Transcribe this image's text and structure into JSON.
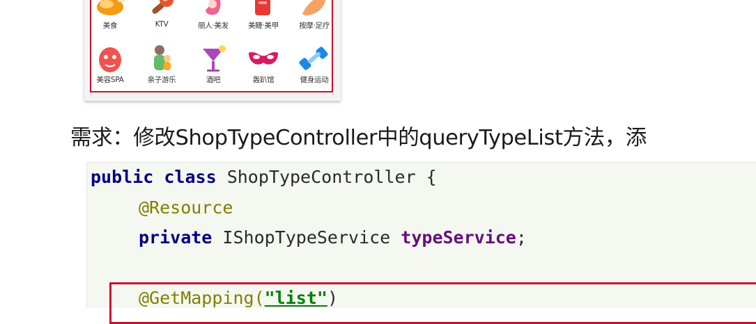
{
  "categories": [
    {
      "label": "美食",
      "icon": "roast-chicken-icon",
      "color": "#f39c12"
    },
    {
      "label": "KTV",
      "icon": "microphone-icon",
      "color": "#e8552b"
    },
    {
      "label": "丽人·美发",
      "icon": "hair-salon-icon",
      "color": "#f06292"
    },
    {
      "label": "美睫·美甲",
      "icon": "nail-polish-icon",
      "color": "#e53935"
    },
    {
      "label": "按摩·足疗",
      "icon": "foot-massage-icon",
      "color": "#f4a261"
    },
    {
      "label": "美容SPA",
      "icon": "face-mask-icon",
      "color": "#ef5350"
    },
    {
      "label": "亲子游乐",
      "icon": "parent-child-icon",
      "color": "#8d6e63"
    },
    {
      "label": "酒吧",
      "icon": "cocktail-icon",
      "color": "#ab47bc"
    },
    {
      "label": "轰趴馆",
      "icon": "party-mask-icon",
      "color": "#d81b60"
    },
    {
      "label": "健身运动",
      "icon": "dumbbell-icon",
      "color": "#1e88e5"
    }
  ],
  "requirement": "需求：修改ShopTypeController中的queryTypeList方法，添",
  "code": {
    "line1_kw1": "public",
    "line1_kw2": "class",
    "line1_rest": " ShopTypeController {",
    "line2_annotation": "@Resource",
    "line3_kw": "private",
    "line3_type": " IShopTypeService ",
    "line3_field": "typeService",
    "line3_end": ";",
    "line5_annotation": "@GetMapping(",
    "line5_string": "\"list\"",
    "line5_end": ")"
  }
}
